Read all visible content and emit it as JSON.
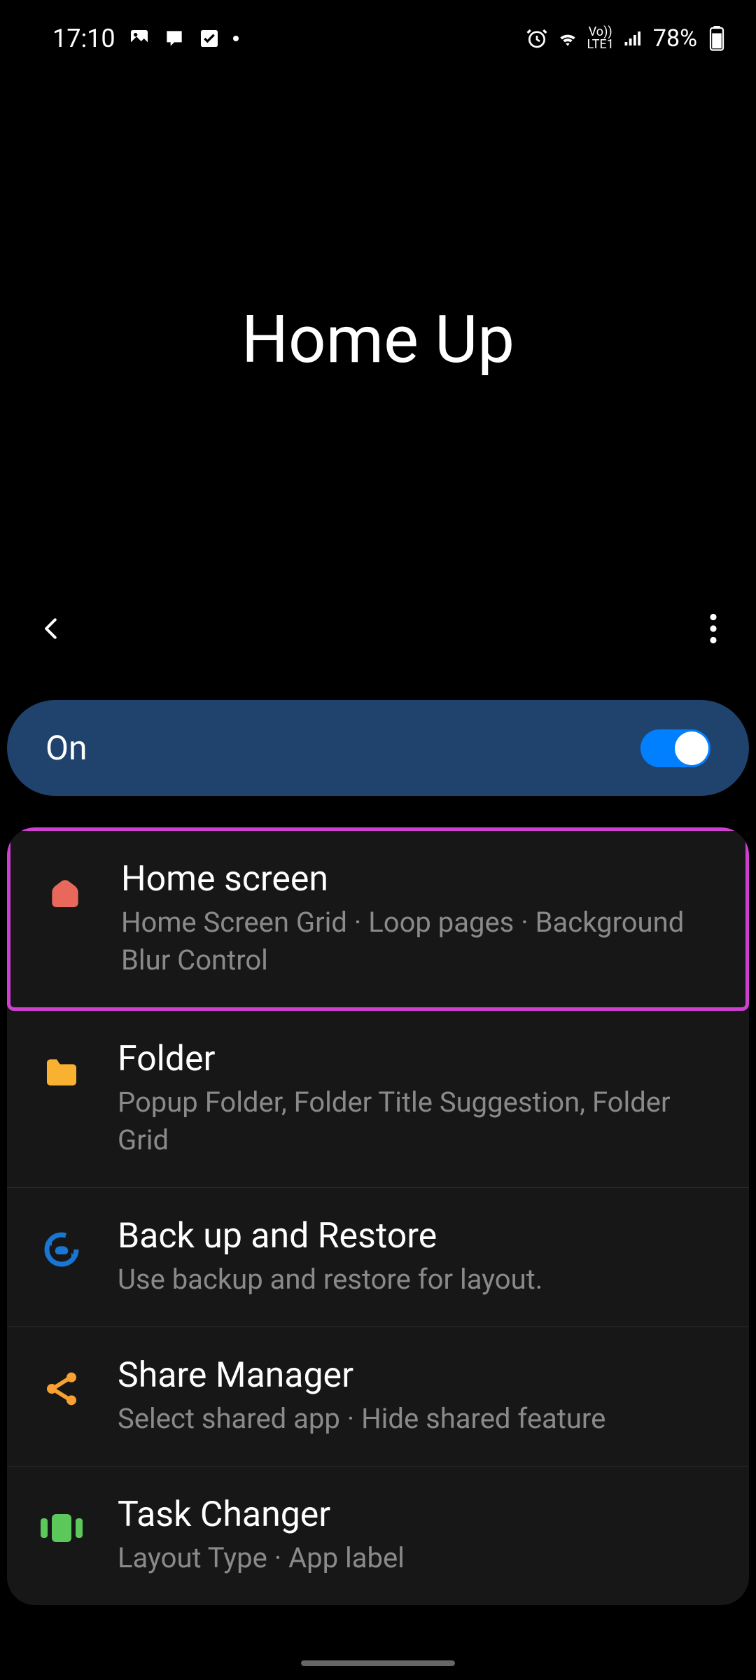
{
  "status_bar": {
    "time": "17:10",
    "battery": "78%"
  },
  "page_title": "Home Up",
  "toggle": {
    "label": "On",
    "value": true
  },
  "list_items": [
    {
      "title": "Home screen",
      "subtitle": "Home Screen Grid · Loop pages · Background Blur Control",
      "highlighted": true,
      "icon_color": "#e8685c"
    },
    {
      "title": "Folder",
      "subtitle": "Popup Folder, Folder Title Suggestion, Folder Grid",
      "icon_color": "#f8b130"
    },
    {
      "title": "Back up and Restore",
      "subtitle": "Use backup and restore for layout.",
      "icon_color": "#1976d2"
    },
    {
      "title": "Share Manager",
      "subtitle": "Select shared app · Hide shared feature",
      "icon_color": "#f8a030"
    },
    {
      "title": "Task Changer",
      "subtitle": "Layout Type · App label",
      "icon_color": "#5cc85c"
    }
  ]
}
